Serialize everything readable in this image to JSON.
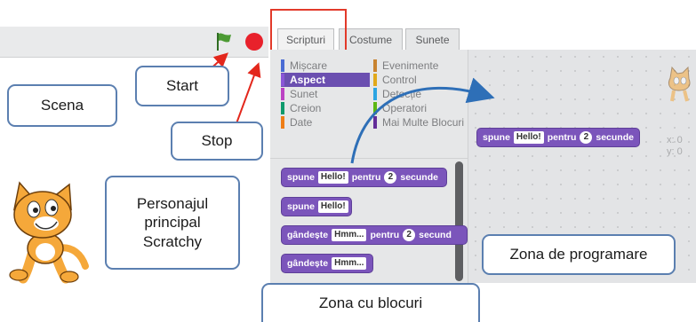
{
  "stage": {
    "start_icon": "green-flag-icon",
    "stop_icon": "stop-sign-icon"
  },
  "tabs": [
    {
      "label": "Scripturi",
      "active": true
    },
    {
      "label": "Costume",
      "active": false
    },
    {
      "label": "Sunete",
      "active": false
    }
  ],
  "categories": {
    "left": [
      {
        "label": "Mișcare",
        "color": "#4a6cd4"
      },
      {
        "label": "Aspect",
        "color": "#8a55d7",
        "active": true
      },
      {
        "label": "Sunet",
        "color": "#bb42c3"
      },
      {
        "label": "Creion",
        "color": "#0e9a6c"
      },
      {
        "label": "Date",
        "color": "#ee7d16"
      }
    ],
    "right": [
      {
        "label": "Evenimente",
        "color": "#c88330"
      },
      {
        "label": "Control",
        "color": "#e1a91a"
      },
      {
        "label": "Detecție",
        "color": "#2ca5e2"
      },
      {
        "label": "Operatori",
        "color": "#5cb712"
      },
      {
        "label": "Mai Multe Blocuri",
        "color": "#632d99"
      }
    ]
  },
  "palette_blocks": {
    "b1": {
      "pre": "spune",
      "arg": "Hello!",
      "mid": "pentru",
      "num": "2",
      "post": "secunde"
    },
    "b2": {
      "pre": "spune",
      "arg": "Hello!"
    },
    "b3": {
      "pre": "gândește",
      "arg": "Hmm...",
      "mid": "pentru",
      "num": "2",
      "post": "secund"
    },
    "b4": {
      "pre": "gândește",
      "arg": "Hmm..."
    }
  },
  "script_block": {
    "pre": "spune",
    "arg": "Hello!",
    "mid": "pentru",
    "num": "2",
    "post": "secunde"
  },
  "coords": {
    "x": "x: 0",
    "y": "y: 0"
  },
  "callouts": {
    "scena": "Scena",
    "start": "Start",
    "stop": "Stop",
    "personaj": [
      "Personajul",
      "principal",
      "Scratchy"
    ],
    "zona_blocuri": "Zona cu blocuri",
    "zona_programare": "Zona de programare"
  },
  "colors": {
    "accent_red": "#e23a2a",
    "block_purple": "#7b55bb",
    "flag_green": "#3f8f2f"
  }
}
